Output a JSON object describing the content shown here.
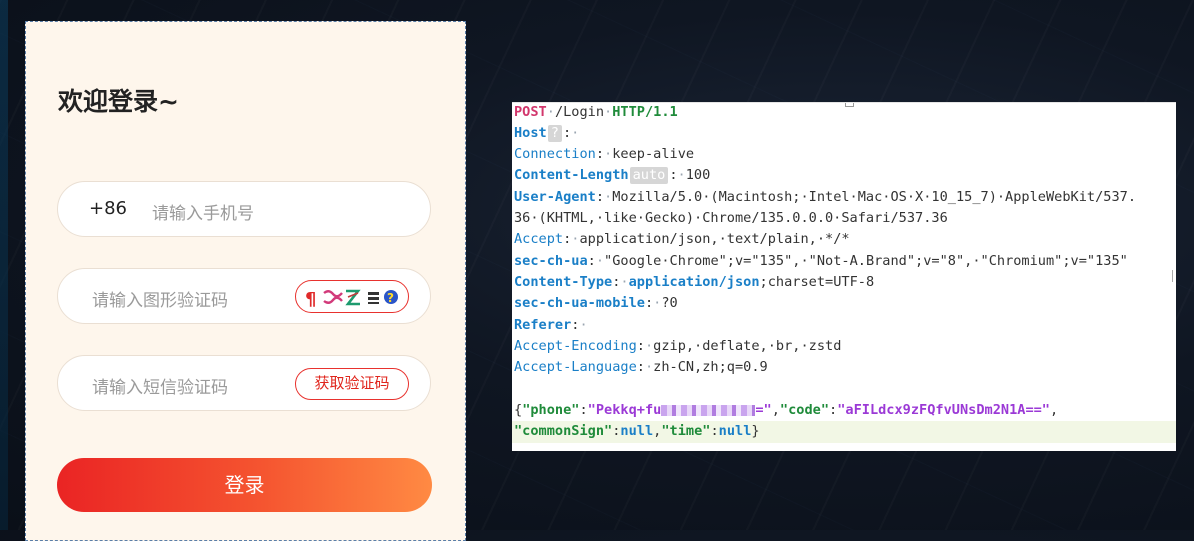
{
  "login": {
    "title": "欢迎登录~",
    "phone_prefix": "+86",
    "phone_placeholder": "请输入手机号",
    "captcha_placeholder": "请输入图形验证码",
    "sms_placeholder": "请输入短信验证码",
    "sms_button": "获取验证码",
    "submit": "登录"
  },
  "request": {
    "method": "POST",
    "path": "/Login",
    "version": "HTTP/1.1",
    "host_label": "Host",
    "host_badge": "?",
    "connection_label": "Connection",
    "connection_value": "keep-alive",
    "content_length_label": "Content-Length",
    "content_length_badge": "auto",
    "content_length_value": "100",
    "ua_label": "User-Agent",
    "ua_value_1": "Mozilla/5.0·(Macintosh;·Intel·Mac·OS·X·10_15_7)·AppleWebKit/537.",
    "ua_value_2": "36·(KHTML,·like·Gecko)·Chrome/135.0.0.0·Safari/537.36",
    "accept_label": "Accept",
    "accept_value": "application/json,·text/plain,·*/*",
    "sec_ch_ua_label": "sec-ch-ua",
    "sec_ch_ua_value": "\"Google·Chrome\";v=\"135\",·\"Not-A.Brand\";v=\"8\",·\"Chromium\";v=\"135\"",
    "content_type_label": "Content-Type",
    "content_type_value": "application/json",
    "content_type_rest": ";charset=UTF-8",
    "mobile_label": "sec-ch-ua-mobile",
    "mobile_value": "?0",
    "referer_label": "Referer",
    "encoding_label": "Accept-Encoding",
    "encoding_value": "gzip,·deflate,·br,·zstd",
    "language_label": "Accept-Language",
    "language_value": "zh-CN,zh;q=0.9",
    "body": {
      "phone_key": "\"phone\"",
      "phone_val_start": "\"Pekkq+fu",
      "phone_val_end": "=\"",
      "code_key": "\"code\"",
      "code_val": "\"aFILdcx9zFQfvUNsDm2N1A==\"",
      "sign_key": "\"commonSign\"",
      "sign_val": "null",
      "time_key": "\"time\"",
      "time_val": "null"
    }
  }
}
